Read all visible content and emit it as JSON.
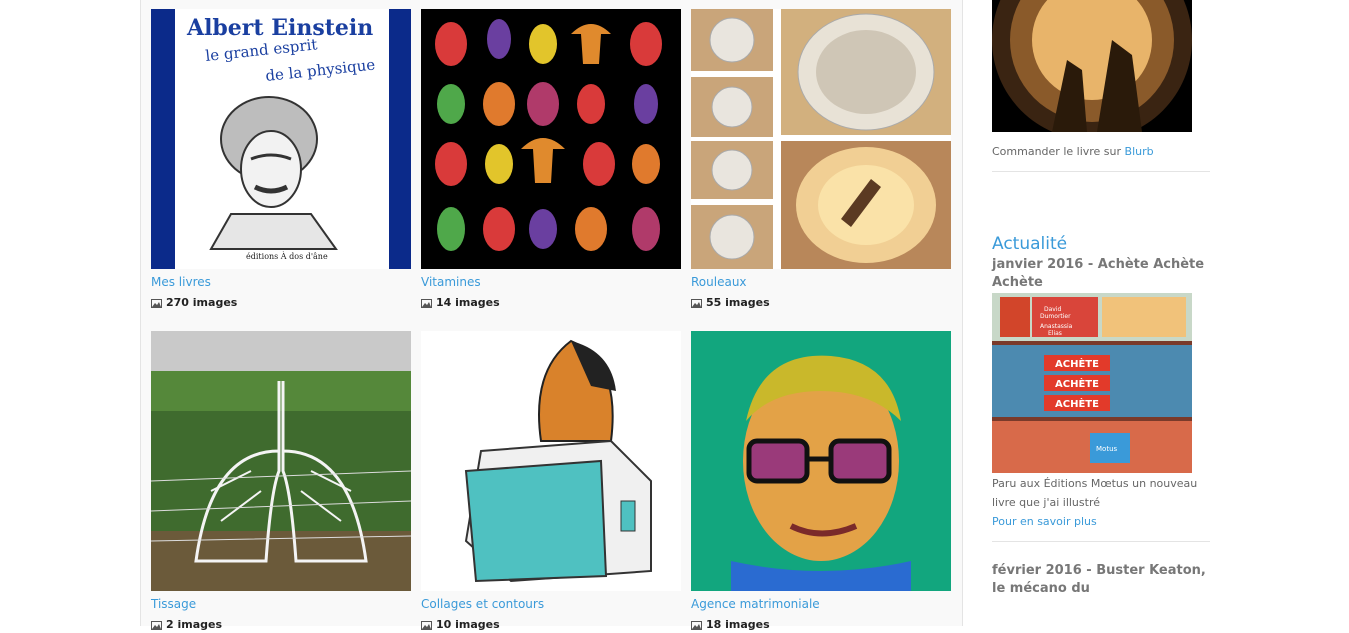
{
  "albums": [
    {
      "title": "Mes livres",
      "count": "270 images",
      "cover_heading": "Albert Einstein",
      "cover_subtitle_1": "le grand esprit",
      "cover_subtitle_2": "de la physique",
      "cover_publisher": "éditions À dos d'âne"
    },
    {
      "title": "Vitamines",
      "count": "14 images"
    },
    {
      "title": "Rouleaux",
      "count": "55 images"
    },
    {
      "title": "Tissage",
      "count": "2 images"
    },
    {
      "title": "Collages et contours",
      "count": "10 images"
    },
    {
      "title": "Agence matrimoniale",
      "count": "18 images"
    }
  ],
  "sidebar": {
    "order_text": "Commander le livre sur ",
    "order_link": "Blurb",
    "news_heading": "Actualité",
    "news": [
      {
        "title": "janvier 2016 - Achète Achète Achète",
        "body": "Paru aux Éditions Mœtus un nouveau livre que j'ai illustré",
        "more": "Pour en savoir plus",
        "cover_word": "ACHÈTE",
        "cover_authors_1": "David",
        "cover_authors_2": "Dumortier",
        "cover_authors_3": "Anastassia",
        "cover_authors_4": "Elias",
        "cover_brand": "Motus"
      },
      {
        "title": "février 2016 - Buster Keaton, le mécano du"
      }
    ]
  },
  "colors": {
    "link": "#3a9ad9",
    "heading": "#777777",
    "panel": "#f9f9f9"
  }
}
